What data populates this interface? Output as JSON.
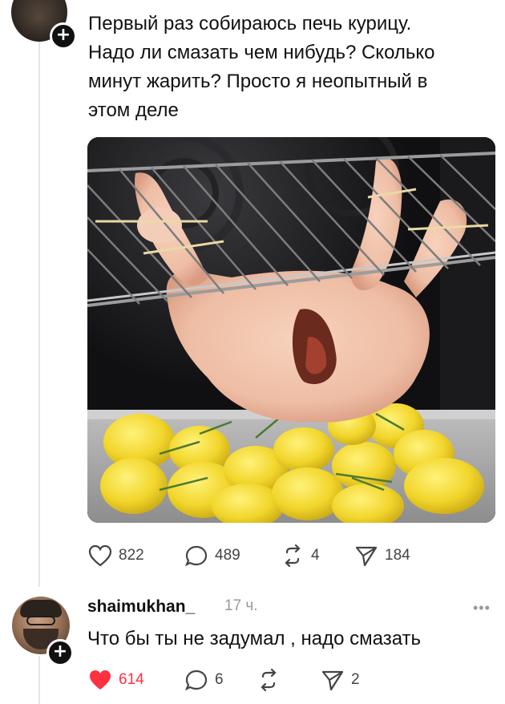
{
  "post": {
    "text": "Первый раз собираюсь печь курицу.\nНадо ли смазать чем нибудь? Сколько\nминут жарить? Просто я неопытный в\nэтом деле",
    "stats": {
      "likes": "822",
      "comments": "489",
      "reposts": "4",
      "shares": "184"
    }
  },
  "reply": {
    "username": "shaimukhan_",
    "time": "17 ч.",
    "text": "Что бы ты не задумал , надо смазать",
    "stats": {
      "likes": "614",
      "comments": "6",
      "reposts": "",
      "shares": "2"
    }
  },
  "colors": {
    "like_red": "#ff3040",
    "icon_gray": "#444444",
    "muted": "#999999"
  }
}
